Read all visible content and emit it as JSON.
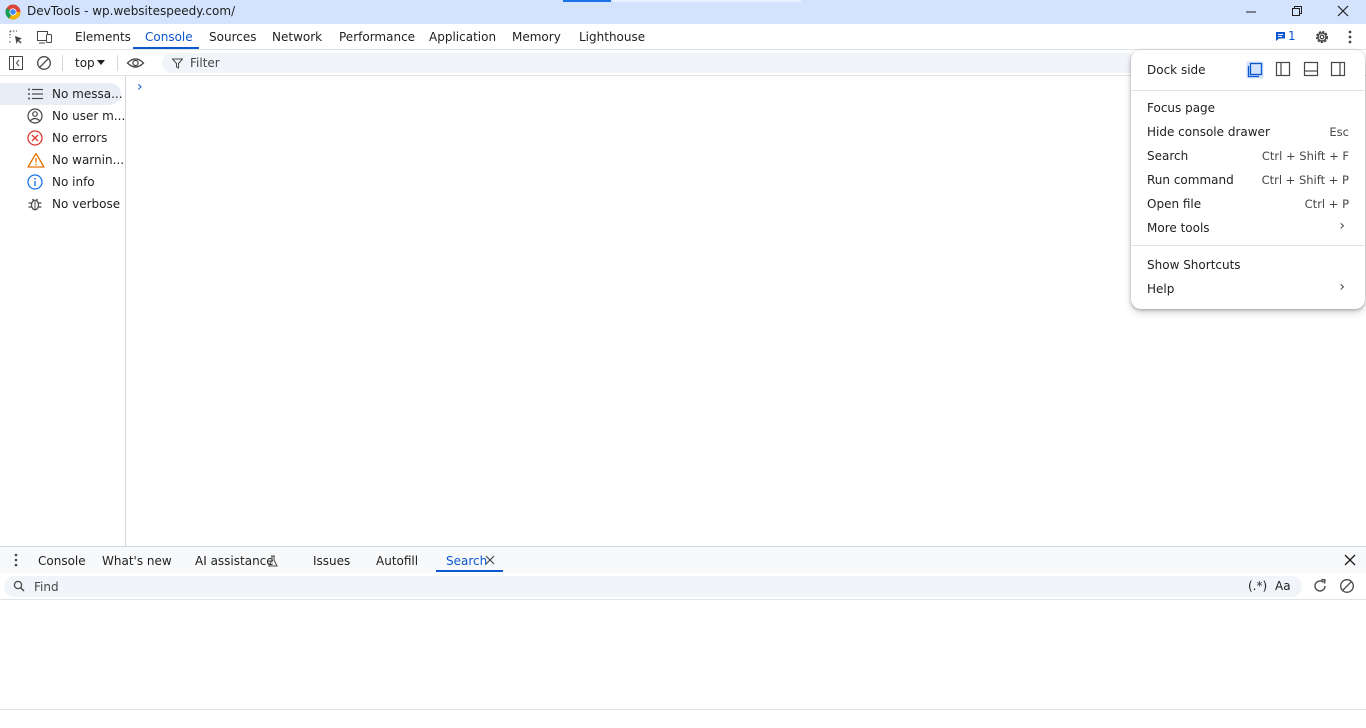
{
  "window": {
    "title": "DevTools - wp.websitespeedy.com/"
  },
  "tabs": [
    {
      "label": "Elements"
    },
    {
      "label": "Console"
    },
    {
      "label": "Sources"
    },
    {
      "label": "Network"
    },
    {
      "label": "Performance"
    },
    {
      "label": "Application"
    },
    {
      "label": "Memory"
    },
    {
      "label": "Lighthouse"
    }
  ],
  "issues_count": "1",
  "console_toolbar": {
    "context": "top",
    "filter_placeholder": "Filter"
  },
  "sidebar": {
    "items": [
      {
        "label": "No messa...",
        "icon": "list-icon"
      },
      {
        "label": "No user m...",
        "icon": "user-icon"
      },
      {
        "label": "No errors",
        "icon": "error-icon"
      },
      {
        "label": "No warnin...",
        "icon": "warning-icon"
      },
      {
        "label": "No info",
        "icon": "info-icon"
      },
      {
        "label": "No verbose",
        "icon": "bug-icon"
      }
    ]
  },
  "prompt_symbol": "›",
  "drawer": {
    "tabs": [
      {
        "label": "Console"
      },
      {
        "label": "What's new"
      },
      {
        "label": "AI assistance"
      },
      {
        "label": "Issues"
      },
      {
        "label": "Autofill"
      },
      {
        "label": "Search"
      }
    ],
    "find_placeholder": "Find",
    "regex_label": "(.*)",
    "case_label": "Aa"
  },
  "menu": {
    "dock_side_label": "Dock side",
    "items": [
      {
        "label": "Focus page",
        "shortcut": ""
      },
      {
        "label": "Hide console drawer",
        "shortcut": "Esc"
      },
      {
        "label": "Search",
        "shortcut": "Ctrl + Shift + F"
      },
      {
        "label": "Run command",
        "shortcut": "Ctrl + Shift + P"
      },
      {
        "label": "Open file",
        "shortcut": "Ctrl + P"
      },
      {
        "label": "More tools",
        "shortcut": "›"
      },
      {
        "label": "Show Shortcuts",
        "shortcut": ""
      },
      {
        "label": "Help",
        "shortcut": "›"
      }
    ]
  },
  "colors": {
    "accent": "#0b57d0",
    "titlebar": "#d3e3fd",
    "error": "#dc362e",
    "warning": "#e37400",
    "info": "#1a73e8"
  }
}
